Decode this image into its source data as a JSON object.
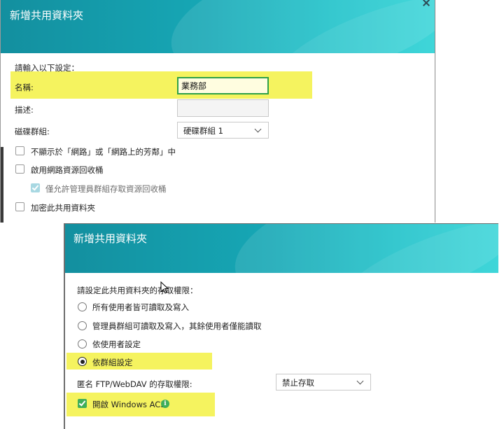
{
  "dialog1": {
    "title": "新增共用資料夾",
    "prompt": "請輸入以下設定：",
    "name_label": "名稱:",
    "name_value": "業務部",
    "desc_label": "描述:",
    "desc_value": "",
    "diskgroup_label": "磁碟群組:",
    "diskgroup_value": "硬碟群組 1",
    "options": [
      {
        "label": "不顯示於「網路」或「網路上的芳鄰」中",
        "checked": false
      },
      {
        "label": "啟用網路資源回收桶",
        "checked": false
      },
      {
        "label": "僅允許管理員群組存取資源回收桶",
        "checked": true,
        "disabled": true
      },
      {
        "label": "加密此共用資料夾",
        "checked": false
      }
    ]
  },
  "dialog2": {
    "title": "新增共用資料夾",
    "prompt": "請設定此共用資料夾的存取權限：",
    "radios": [
      {
        "label": "所有使用者皆可讀取及寫入",
        "selected": false
      },
      {
        "label": "管理員群組可讀取及寫入，其餘使用者僅能讀取",
        "selected": false
      },
      {
        "label": "依使用者設定",
        "selected": false
      },
      {
        "label": "依群組設定",
        "selected": true
      }
    ],
    "ftp_label": "匿名 FTP/WebDAV 的存取權限:",
    "ftp_value": "禁止存取",
    "acl_label": "開啟 Windows ACL",
    "acl_checked": true,
    "acl_info_icon": "info-icon"
  },
  "colors": {
    "header_gradient_start": "#138f9f",
    "header_gradient_end": "#2fd3d6",
    "highlight": "#f5f35f",
    "accent_green": "#3fae5a"
  }
}
